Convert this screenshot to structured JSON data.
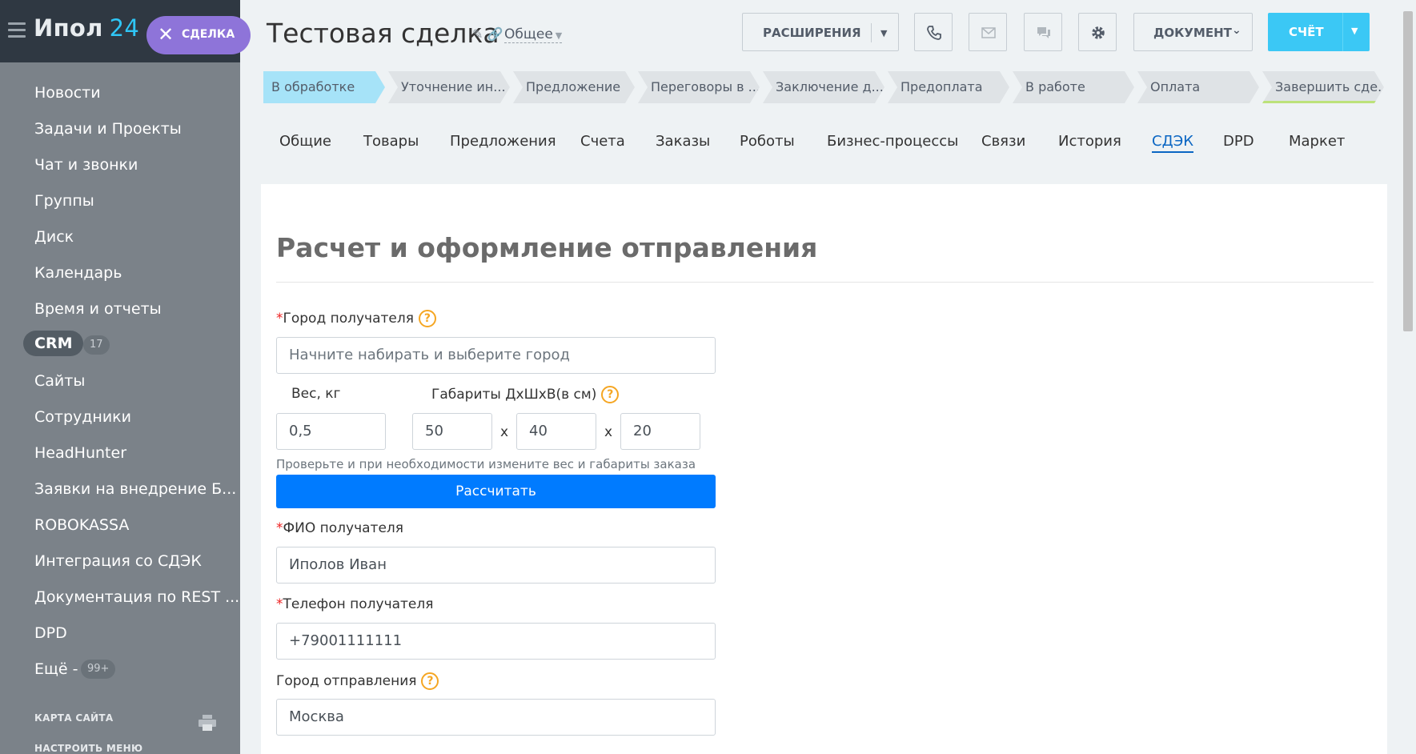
{
  "sidebar": {
    "logo_name": "Ипол",
    "logo_num": "24",
    "close_label": "СДЕЛКА",
    "items": [
      {
        "label": "Новости"
      },
      {
        "label": "Задачи и Проекты"
      },
      {
        "label": "Чат и звонки"
      },
      {
        "label": "Группы"
      },
      {
        "label": "Диск"
      },
      {
        "label": "Календарь"
      },
      {
        "label": "Время и отчеты"
      }
    ],
    "crm": {
      "label": "CRM",
      "badge": "17"
    },
    "items2": [
      {
        "label": "Сайты"
      },
      {
        "label": "Сотрудники"
      },
      {
        "label": "HeadHunter"
      },
      {
        "label": "Заявки на внедрение Б..."
      },
      {
        "label": "ROBOKASSA"
      },
      {
        "label": "Интеграция со СДЭК"
      },
      {
        "label": "Документация по REST ..."
      },
      {
        "label": "DPD"
      }
    ],
    "more": {
      "label": "Ещё -",
      "badge": "99+"
    },
    "sitemap": "КАРТА САЙТА",
    "configure_menu": "НАСТРОИТЬ МЕНЮ"
  },
  "header": {
    "title": "Тестовая  сделка",
    "category": "Общее",
    "extensions_label": "РАСШИРЕНИЯ",
    "document_label": "ДОКУМЕНТ",
    "invoice_label": "СЧЁТ"
  },
  "stages": [
    {
      "label": "В обработке"
    },
    {
      "label": "Уточнение ин..."
    },
    {
      "label": "Предложение"
    },
    {
      "label": "Переговоры в ..."
    },
    {
      "label": "Заключение д..."
    },
    {
      "label": "Предоплата"
    },
    {
      "label": "В работе"
    },
    {
      "label": "Оплата"
    },
    {
      "label": "Завершить сде..."
    }
  ],
  "tabs": [
    {
      "label": "Общие"
    },
    {
      "label": "Товары"
    },
    {
      "label": "Предложения"
    },
    {
      "label": "Счета"
    },
    {
      "label": "Заказы"
    },
    {
      "label": "Роботы"
    },
    {
      "label": "Бизнес-процессы"
    },
    {
      "label": "Связи"
    },
    {
      "label": "История"
    },
    {
      "label": "СДЭК"
    },
    {
      "label": "DPD"
    },
    {
      "label": "Маркет"
    }
  ],
  "form": {
    "heading": "Расчет и оформление отправления",
    "city_label": "Город получателя",
    "city_placeholder": "Начните набирать и выберите город",
    "weight_label": "Вес, кг",
    "dims_label": "Габариты ДхШхВ(в см)",
    "weight": "0,5",
    "length": "50",
    "width": "40",
    "height": "20",
    "x": "x",
    "hint": "Проверьте и при необходимости измените вес и габариты заказа",
    "calc_label": "Рассчитать",
    "name_label": "ФИО получателя",
    "name_value": "Иполов Иван",
    "phone_label": "Телефон получателя",
    "phone_value": "+79001111111",
    "from_city_label": "Город отправления",
    "from_city_value": "Москва",
    "required_mark": "*",
    "help_mark": "?"
  },
  "colors": {
    "accent": "#3bc8f5",
    "primary_button": "#007bff",
    "active_tab": "#0b66c3",
    "sidebar_bg": "#7b8289"
  }
}
